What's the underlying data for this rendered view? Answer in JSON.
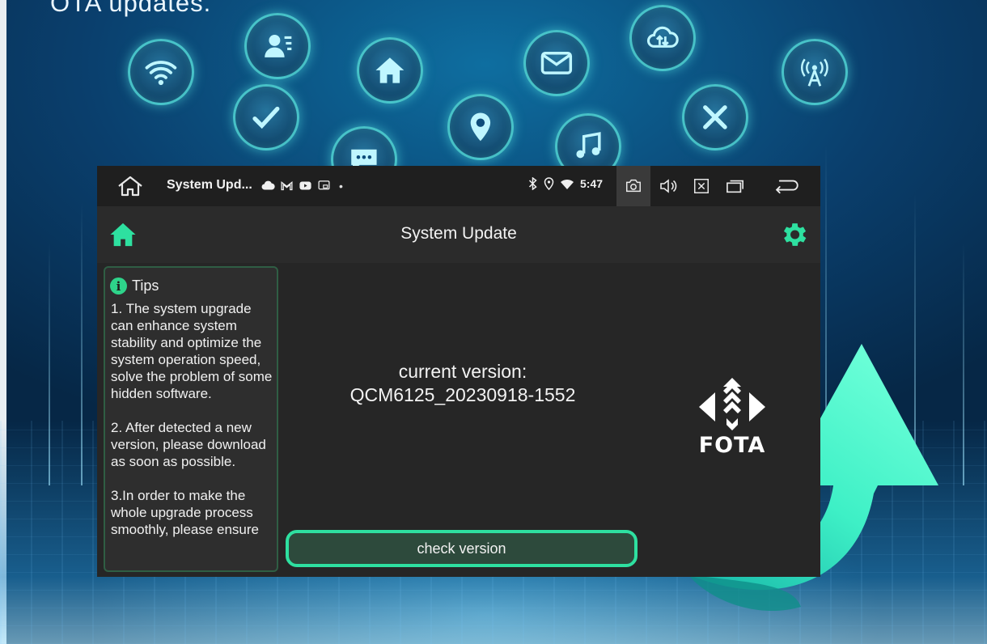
{
  "headline": "OTA updates.",
  "background_icons": [
    "wifi-icon",
    "contact-icon",
    "home-icon",
    "mail-icon",
    "cloud-sync-icon",
    "antenna-icon",
    "check-icon",
    "location-icon",
    "music-icon",
    "close-icon",
    "chat-icon"
  ],
  "statusbar": {
    "app_title": "System Upd...",
    "notification_icons": [
      "cloud-icon",
      "gmail-icon",
      "youtube-icon",
      "cast-icon"
    ],
    "dot": "•",
    "time": "5:47",
    "status_icons": [
      "bluetooth-icon",
      "location-pin-icon",
      "wifi-icon"
    ]
  },
  "appbar": {
    "title": "System Update"
  },
  "tips": {
    "heading": "Tips",
    "items": [
      "1. The system upgrade can enhance system stability and optimize the system operation speed, solve the problem of some hidden software.",
      "2. After detected a new version, please download as soon as possible.",
      "3.In order to make the whole upgrade process smoothly, please ensure"
    ]
  },
  "version": {
    "label": "current version:",
    "value": "QCM6125_20230918-1552"
  },
  "actions": {
    "check_label": "check version"
  },
  "logo": {
    "text": "FOTA"
  },
  "colors": {
    "accent": "#2ee0a0",
    "app_bg": "#262626",
    "background": "#0a3f6d"
  }
}
